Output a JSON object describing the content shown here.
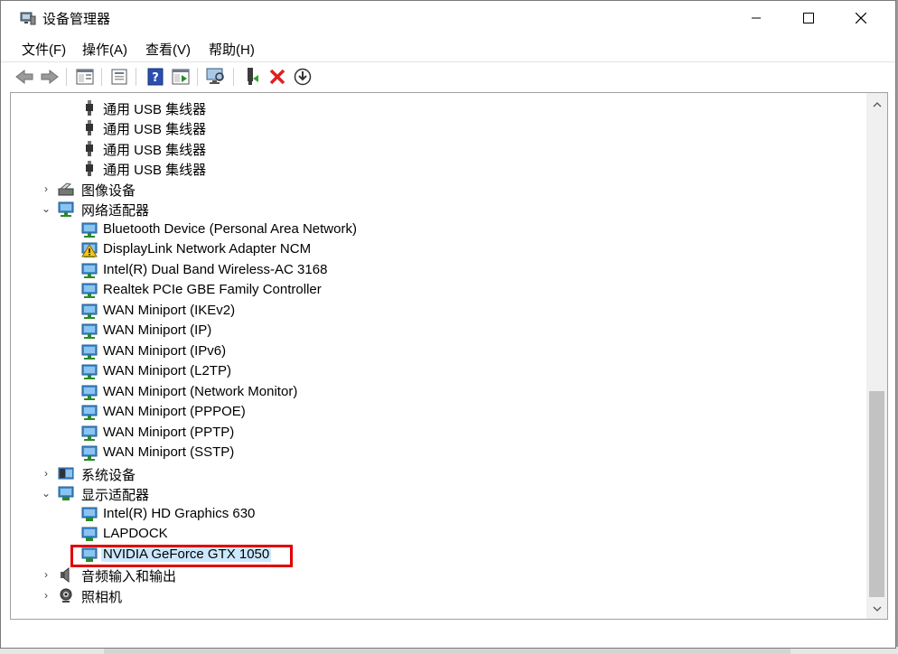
{
  "window": {
    "title": "设备管理器"
  },
  "menu": [
    "文件(F)",
    "操作(A)",
    "查看(V)",
    "帮助(H)"
  ],
  "toolbar": {
    "buttons": [
      "back",
      "forward",
      "properties-view",
      "update-view",
      "help",
      "show-hide",
      "scan-hardware",
      "enable-device",
      "uninstall-device",
      "update-driver"
    ]
  },
  "tree": {
    "usb_hubs": [
      "通用 USB 集线器",
      "通用 USB 集线器",
      "通用 USB 集线器",
      "通用 USB 集线器"
    ],
    "imaging": "图像设备",
    "network": {
      "label": "网络适配器",
      "items": [
        "Bluetooth Device (Personal Area Network)",
        "DisplayLink Network Adapter NCM",
        "Intel(R) Dual Band Wireless-AC 3168",
        "Realtek PCIe GBE Family Controller",
        "WAN Miniport (IKEv2)",
        "WAN Miniport (IP)",
        "WAN Miniport (IPv6)",
        "WAN Miniport (L2TP)",
        "WAN Miniport (Network Monitor)",
        "WAN Miniport (PPPOE)",
        "WAN Miniport (PPTP)",
        "WAN Miniport (SSTP)"
      ]
    },
    "system": "系统设备",
    "display": {
      "label": "显示适配器",
      "items": [
        "Intel(R) HD Graphics 630",
        "LAPDOCK",
        "NVIDIA GeForce GTX 1050"
      ]
    },
    "audio": "音频输入和输出",
    "camera": "照相机"
  },
  "colors": {
    "highlight_border": "#e00000",
    "selection": "#cce8ff"
  }
}
